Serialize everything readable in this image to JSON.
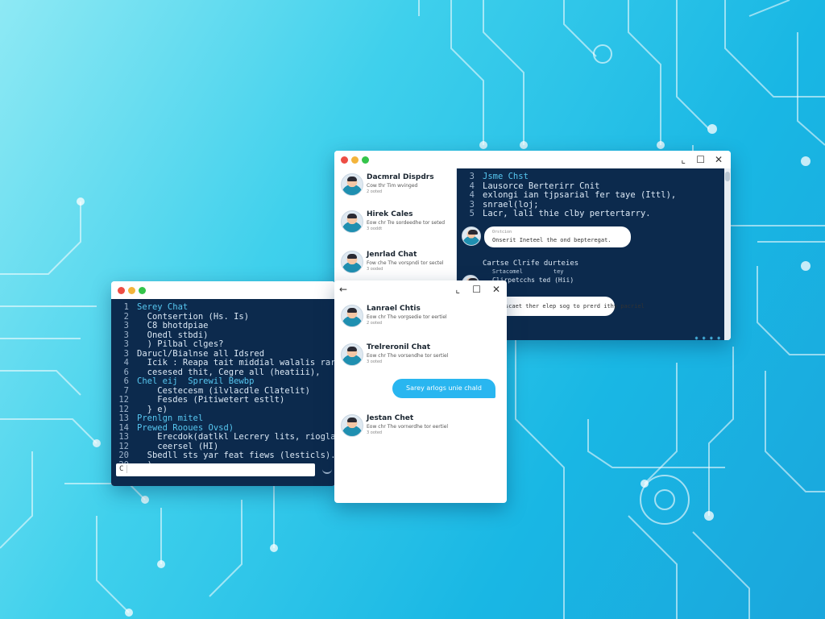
{
  "colors": {
    "accent": "#29b6f0",
    "code_bg": "#0c2a4d",
    "keyword": "#57c7f0"
  },
  "window_controls": {
    "minimize": "⌞",
    "maximize": "☐",
    "close": "✕",
    "back": "←"
  },
  "left_window": {
    "code_lines": [
      {
        "n": "1",
        "text": "Serey Chat",
        "kw": true
      },
      {
        "n": "2",
        "text": "  Contsertion (Hs. Is)",
        "kw": false
      },
      {
        "n": "3",
        "text": "  C8 bhotdpiae",
        "kw": false
      },
      {
        "n": "3",
        "text": "  Onedl stbdi)",
        "kw": false
      },
      {
        "n": "3",
        "text": "  ) Pilbal clges?",
        "kw": false
      },
      {
        "n": "3",
        "text": "Darucl/Bialnse all Idsred",
        "kw": false
      },
      {
        "n": "4",
        "text": "  Icik : Reapa tait middial walalis rar Iodic",
        "kw": false
      },
      {
        "n": "6",
        "text": "  cesesed thit, Cegre all (heatiii),",
        "kw": false
      },
      {
        "n": "6",
        "text": "Chel eij  Sprewil Bewbp",
        "kw": true
      },
      {
        "n": "7",
        "text": "    Cestecesm (ilvlacdle Clatelit)",
        "kw": false
      },
      {
        "n": "12",
        "text": "    Fesdes (Pitiwetert estlt)",
        "kw": false
      },
      {
        "n": "12",
        "text": "  } e)",
        "kw": false
      },
      {
        "n": "13",
        "text": "Prenlgn mitel",
        "kw": true
      },
      {
        "n": "14",
        "text": "Prewed Rooues Ovsd)",
        "kw": true
      },
      {
        "n": "13",
        "text": "    Erecdok(datlkl Lecrery lits, rioglan sluat),",
        "kw": false
      },
      {
        "n": "12",
        "text": "    ceersel (HI)",
        "kw": false
      },
      {
        "n": "20",
        "text": "  Sbedll sts yar feat fiews (lesticls).",
        "kw": false
      },
      {
        "n": "20",
        "text": "  )",
        "kw": false
      }
    ],
    "input_prefix": "C"
  },
  "back_window": {
    "contacts": [
      {
        "name": "Dacmral Dispdrs",
        "msg": "Cow thr Tim wvinged",
        "time": "2 ooted"
      },
      {
        "name": "Hirek Cales",
        "msg": "Eow chr Tre sordeedhe tor seted",
        "time": "3 ooddt"
      },
      {
        "name": "Jenrlad Chat",
        "msg": "Fow che The vorspndi tor sectel",
        "time": "3 ooded"
      }
    ],
    "code_lines": [
      {
        "n": "3",
        "text": "Jsme Chst",
        "kw": true
      },
      {
        "n": "4",
        "text": "Lausorce Berterirr Cnit",
        "kw": false
      },
      {
        "n": "4",
        "text": "exlongi ian tjpsarial fer taye (Ittl),",
        "kw": false
      },
      {
        "n": "3",
        "text": "snrael(loj;",
        "kw": false
      },
      {
        "n": "5",
        "text": "Lacr, lali thie clby pertertarry.",
        "kw": false
      }
    ],
    "bubble1": {
      "label": "Orstcion",
      "text": "Onserit Ineteel the ond bepteregat."
    },
    "section_title": "Cartse Clrife durteies",
    "section_line1": "Srtacomel         tey",
    "section_line2": "Clirpetcchs ted (Hii)",
    "bubble2": "scaet ther elep sog to prerd ithy pacriel",
    "footer_icons": "◉ ◉ ◉ ◉"
  },
  "front_window": {
    "contacts": [
      {
        "name": "Lanrael Chtis",
        "msg": "Eow chr The vorgsedie tor eertiel",
        "time": "2 ooted"
      },
      {
        "name": "Trelreronil Chat",
        "msg": "Eow chr The vorsendhe tor sertiel",
        "time": "3 ooted"
      },
      {
        "name": "Jestan Chet",
        "msg": "Eow chr The vornerdhe tor eertiel",
        "time": "3 ooted"
      }
    ],
    "sent_bubble": "Sarey arlogs unie chald"
  }
}
